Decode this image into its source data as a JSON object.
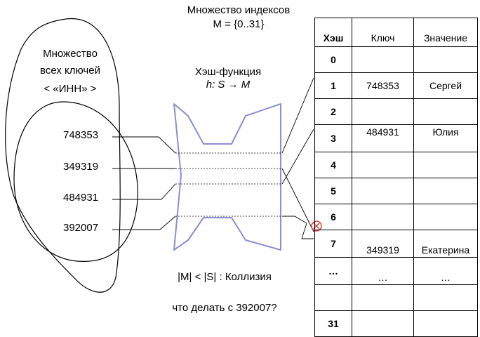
{
  "index_set": {
    "title": "Множество индексов",
    "range": "M = {0..31}"
  },
  "key_set": {
    "line1": "Множество",
    "line2": "всех ключей",
    "line3": "< «ИНН» >"
  },
  "hash_function": {
    "title": "Хэш-функция",
    "signature": "h: S → M"
  },
  "keys": [
    "748353",
    "349319",
    "484931",
    "392007"
  ],
  "collision": {
    "label": "|M| < |S| : Коллизия",
    "question": "что делать с 392007?"
  },
  "table": {
    "headers": [
      "Хэш",
      "Ключ",
      "Значение"
    ],
    "rows": [
      {
        "hash": "0",
        "key": "",
        "value": ""
      },
      {
        "hash": "1",
        "key": "748353",
        "value": "Сергей"
      },
      {
        "hash": "2",
        "key": "",
        "value": ""
      },
      {
        "hash": "3",
        "key": "484931",
        "value": "Юлия"
      },
      {
        "hash": "4",
        "key": "",
        "value": ""
      },
      {
        "hash": "5",
        "key": "",
        "value": ""
      },
      {
        "hash": "6",
        "key": "",
        "value": ""
      },
      {
        "hash": "7",
        "key": "349319",
        "value": "Екатерина"
      },
      {
        "hash": "…",
        "key": "…",
        "value": "…"
      },
      {
        "hash": "",
        "key": "",
        "value": ""
      },
      {
        "hash": "31",
        "key": "",
        "value": ""
      }
    ]
  },
  "colors": {
    "hash_shape": "#8a8fd1",
    "collision_mark": "#d9453a",
    "line": "#000000"
  }
}
